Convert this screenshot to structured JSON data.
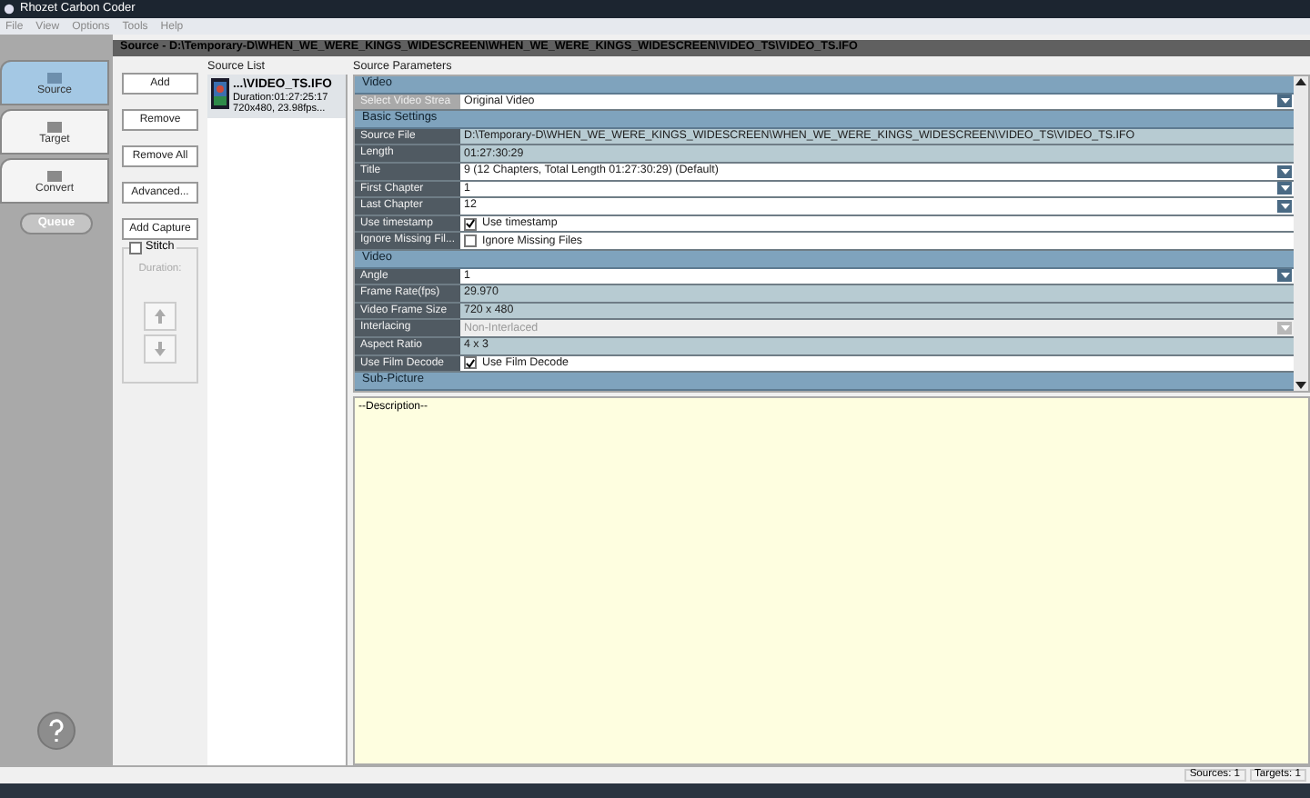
{
  "window": {
    "title": "Rhozet Carbon Coder"
  },
  "menu": [
    "File",
    "View",
    "Options",
    "Tools",
    "Help"
  ],
  "nav": [
    {
      "label": "Source",
      "selected": true
    },
    {
      "label": "Target",
      "selected": false
    },
    {
      "label": "Convert",
      "selected": false
    }
  ],
  "queue_button": "Queue",
  "source_header": "Source - D:\\Temporary-D\\WHEN_WE_WERE_KINGS_WIDESCREEN\\WHEN_WE_WERE_KINGS_WIDESCREEN\\VIDEO_TS\\VIDEO_TS.IFO",
  "buttons": [
    "Add",
    "Remove",
    "Remove All",
    "Advanced...",
    "Add Capture"
  ],
  "stitch": {
    "label": "Stitch",
    "checked": false,
    "duration_label": "Duration:"
  },
  "source_list": {
    "title": "Source List",
    "items": [
      {
        "name": "...\\VIDEO_TS.IFO",
        "duration": "Duration:01:27:25:17",
        "info": "720x480, 23.98fps...",
        "selected": true
      }
    ]
  },
  "parameters": {
    "title": "Source Parameters",
    "rows": [
      {
        "kind": "category",
        "label": "Video"
      },
      {
        "kind": "dropdown",
        "label": "Select Video Strea",
        "value": "Original Video",
        "selected": true
      },
      {
        "kind": "category",
        "label": "Basic Settings"
      },
      {
        "kind": "readonly",
        "label": "Source File",
        "value": "D:\\Temporary-D\\WHEN_WE_WERE_KINGS_WIDESCREEN\\WHEN_WE_WERE_KINGS_WIDESCREEN\\VIDEO_TS\\VIDEO_TS.IFO"
      },
      {
        "kind": "readonly",
        "label": "Length",
        "value": "01:27:30:29"
      },
      {
        "kind": "dropdown",
        "label": "Title",
        "value": "9 (12 Chapters, Total Length 01:27:30:29) (Default)",
        "selected": false
      },
      {
        "kind": "dropdown",
        "label": "First Chapter",
        "value": "1",
        "selected": false
      },
      {
        "kind": "dropdown",
        "label": "Last Chapter",
        "value": "12",
        "selected": false
      },
      {
        "kind": "checkbox",
        "label": "Use timestamp",
        "value": "Use timestamp",
        "checked": true
      },
      {
        "kind": "checkbox",
        "label": "Ignore Missing Fil...",
        "value": "Ignore Missing Files",
        "checked": false
      },
      {
        "kind": "category",
        "label": "Video"
      },
      {
        "kind": "dropdown",
        "label": "Angle",
        "value": "1",
        "selected": false
      },
      {
        "kind": "readonly",
        "label": "Frame Rate(fps)",
        "value": "29.970"
      },
      {
        "kind": "readonly",
        "label": "Video Frame Size",
        "value": "720 x 480"
      },
      {
        "kind": "disabled",
        "label": "Interlacing",
        "value": "Non-Interlaced"
      },
      {
        "kind": "readonly",
        "label": "Aspect Ratio",
        "value": "4 x 3"
      },
      {
        "kind": "checkbox",
        "label": "Use Film Decode",
        "value": "Use Film Decode",
        "checked": true
      },
      {
        "kind": "category",
        "label": "Sub-Picture"
      }
    ]
  },
  "description": "--Description--",
  "status_bar": [
    "Sources: 1",
    "Targets: 1"
  ]
}
